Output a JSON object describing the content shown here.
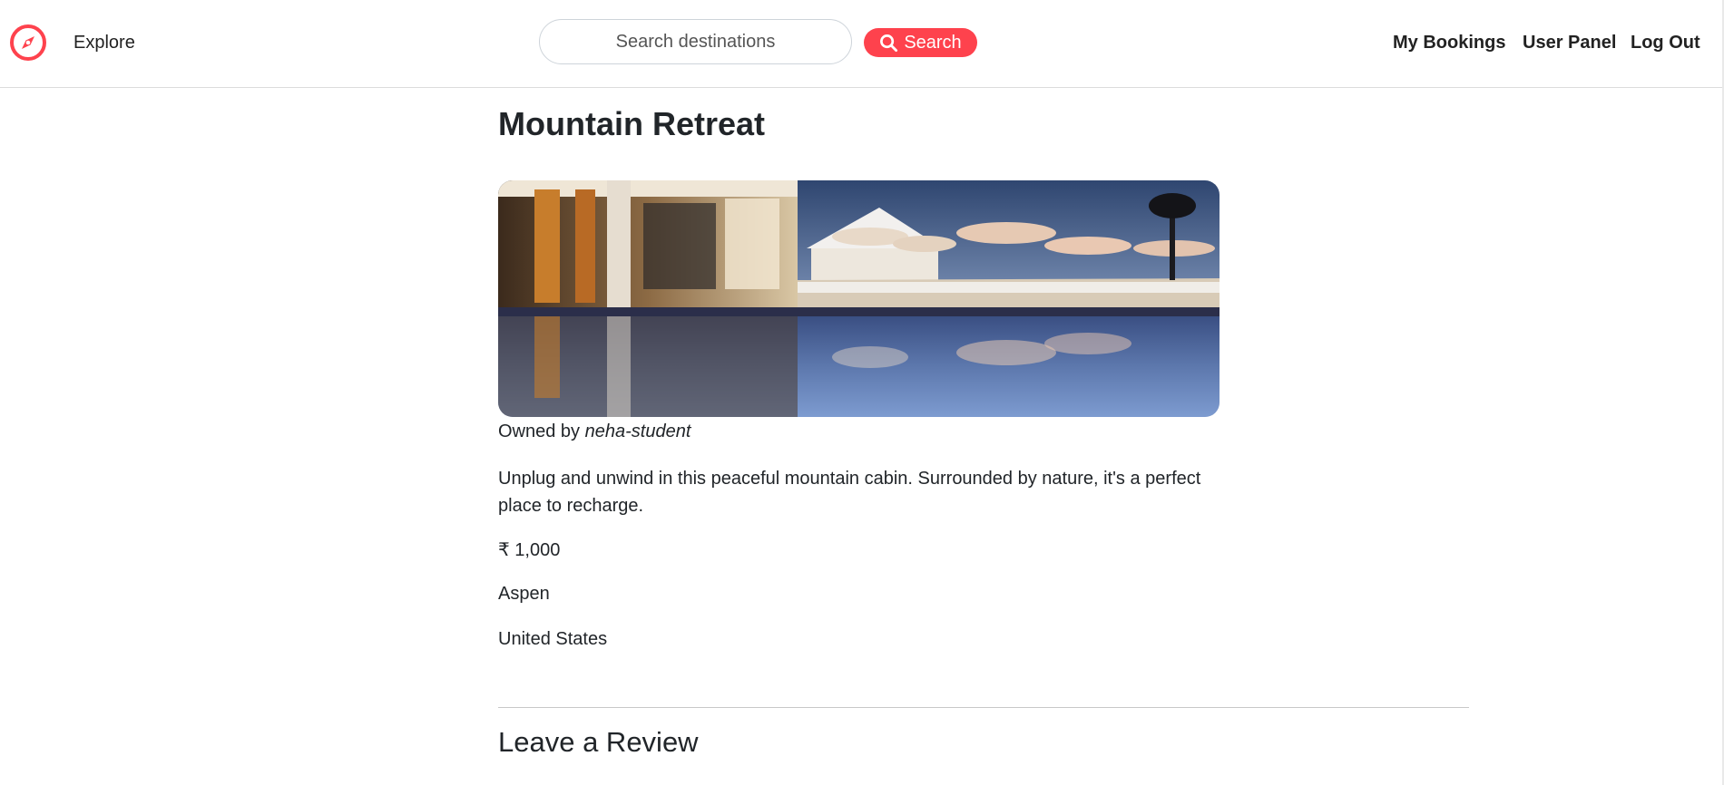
{
  "navbar": {
    "explore_label": "Explore",
    "search_placeholder": "Search destinations",
    "search_button_label": "Search",
    "links": {
      "my_bookings": "My Bookings",
      "user_panel": "User Panel",
      "log_out": "Log Out"
    },
    "brand_icon": "compass-icon",
    "search_icon": "search-icon",
    "accent_color": "#fe424d"
  },
  "listing": {
    "title": "Mountain Retreat",
    "image_alt": "resort-pool-photo",
    "owner_prefix": "Owned by",
    "owner_name": "neha-student",
    "description": "Unplug and unwind in this peaceful mountain cabin. Surrounded by nature, it's a perfect place to recharge.",
    "price": "₹ 1,000",
    "city": "Aspen",
    "country": "United States"
  },
  "reviews": {
    "heading": "Leave a Review"
  }
}
